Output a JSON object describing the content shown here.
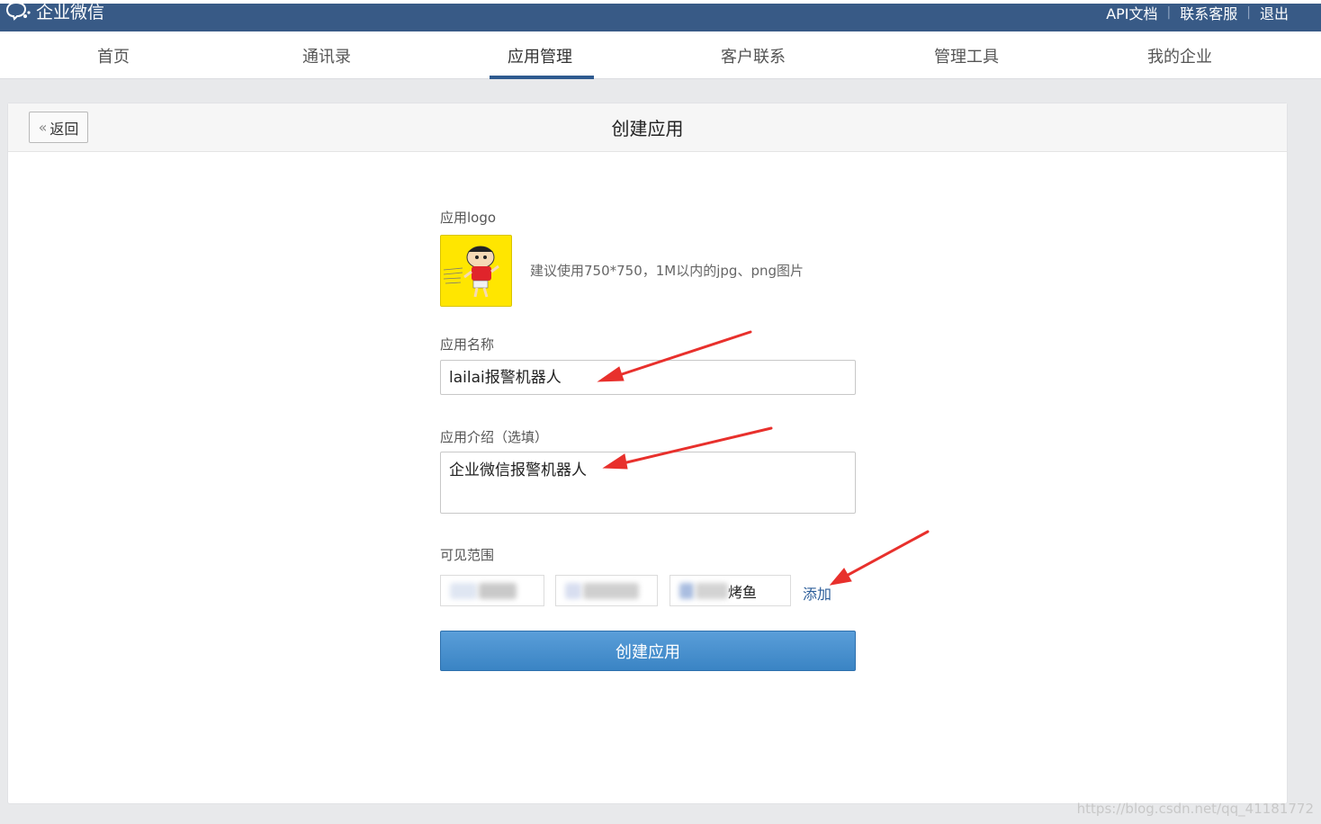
{
  "topbar": {
    "brand": "企业微信",
    "links": [
      "API文档",
      "联系客服",
      "退出"
    ],
    "bg_color": "#385a86"
  },
  "nav": {
    "items": [
      "首页",
      "通讯录",
      "应用管理",
      "客户联系",
      "管理工具",
      "我的企业"
    ],
    "active": "应用管理",
    "accent": "#2e5a8f"
  },
  "panel": {
    "back_label": "返回",
    "title": "创建应用"
  },
  "form": {
    "logo_label": "应用logo",
    "logo_hint": "建议使用750*750，1M以内的jpg、png图片",
    "name_label": "应用名称",
    "name_value": "lailai报警机器人",
    "intro_label": "应用介绍（选填）",
    "intro_value": "企业微信报警机器人",
    "scope_label": "可见范围",
    "scope_tags": [
      "",
      "",
      "烤鱼"
    ],
    "add_label": "添加",
    "submit_label": "创建应用",
    "submit_color": "#4a92d0"
  },
  "watermark": "https://blog.csdn.net/qq_41181772"
}
